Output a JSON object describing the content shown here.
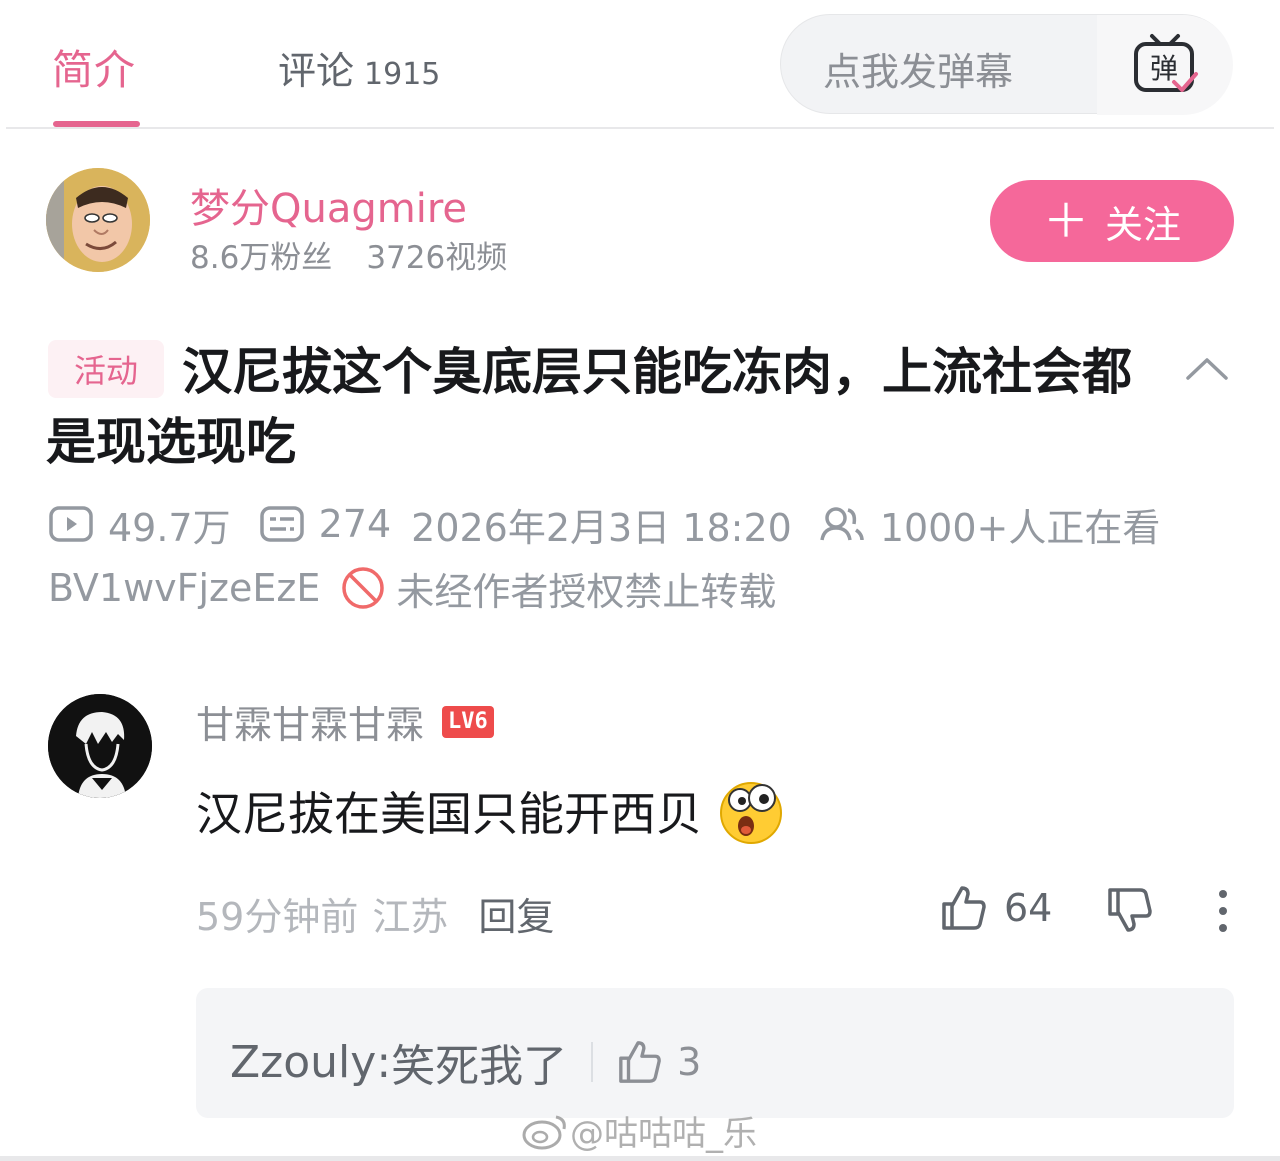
{
  "tabs": {
    "intro_label": "简介",
    "comments_label": "评论",
    "comments_count": "1915",
    "danmaku_placeholder": "点我发弹幕",
    "danmaku_icon_text": "弹"
  },
  "uploader": {
    "name": "梦分Quagmire",
    "fans": "8.6万粉丝",
    "videos": "3726视频",
    "follow_label": "关注",
    "follow_plus": "＋"
  },
  "video": {
    "tag": "活动",
    "title": "汉尼拔这个臭底层只能吃冻肉，上流社会都是现选现吃",
    "views": "49.7万",
    "danmaku_count": "274",
    "date": "2026年2月3日 18:20",
    "watching": "1000+人正在看",
    "bvid": "BV1wvFjzeEzE",
    "copyright": "未经作者授权禁止转载"
  },
  "comment": {
    "user": "甘霖甘霖甘霖",
    "level": "LV6",
    "text": "汉尼拔在美国只能开西贝",
    "time": "59分钟前",
    "location": "江苏",
    "reply_label": "回复",
    "likes": "64"
  },
  "reply": {
    "user": "Zzouly",
    "text": "笑死我了",
    "likes": "3"
  },
  "watermark": "@咕咕咕_乐",
  "colors": {
    "accent": "#e5658f",
    "follow_bg": "#f5689a",
    "level_badge": "#ee4b4b"
  }
}
